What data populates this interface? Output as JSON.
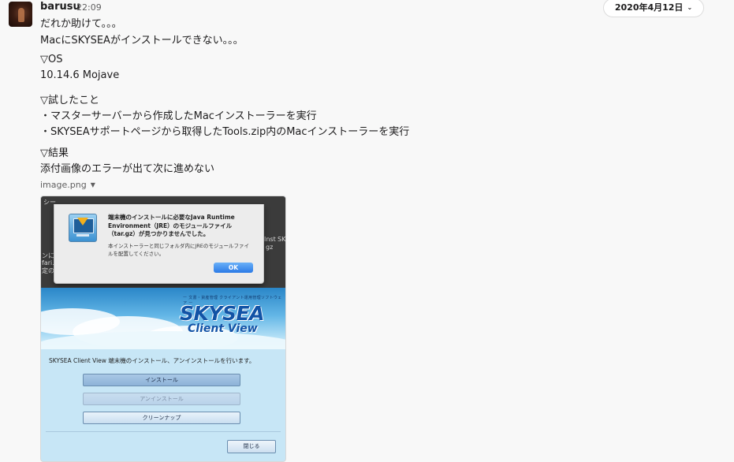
{
  "message": {
    "author": "barusu",
    "time": "22:09",
    "date_divider": "2020年4月12日",
    "lines": [
      "だれか助けて。。。",
      "MacにSKYSEAがインストールできない。。。",
      "▽OS",
      "10.14.6 Mojave",
      "▽試したこと",
      "・マスターサーバーから作成したMacインストーラーを実行",
      "・SKYSEAサポートページから取得したTools.zip内のMacインストーラーを実行",
      "▽結果",
      "添付画像のエラーが出て次に進めない"
    ],
    "attachment_name": "image.png"
  },
  "screenshot": {
    "alert_title": "端末機のインストールに必要なJava Runtime Environment（JRE）のモジュールファイル（tar.gz）が見つかりませんでした。",
    "alert_body": "本インストーラーと同じフォルダ内にJREのモジュールファイルを配置してください。",
    "alert_ok": "OK",
    "banner_subtitle": "ー 文書・資産管理 クライアント運用管理ソフトウェア ー",
    "logo_main": "SKYSEA",
    "logo_sub": "Client View",
    "install_description": "SKYSEA Client View 端末機のインストール、アンインストールを行います。",
    "btn_install": "インストール",
    "btn_uninstall": "アンインストール",
    "btn_cleanup": "クリーンナップ",
    "btn_close": "閉じる",
    "bg_fragments": [
      "シー",
      "Inst",
      "SK",
      "ンに",
      "gz",
      "fari.",
      "定の"
    ]
  }
}
